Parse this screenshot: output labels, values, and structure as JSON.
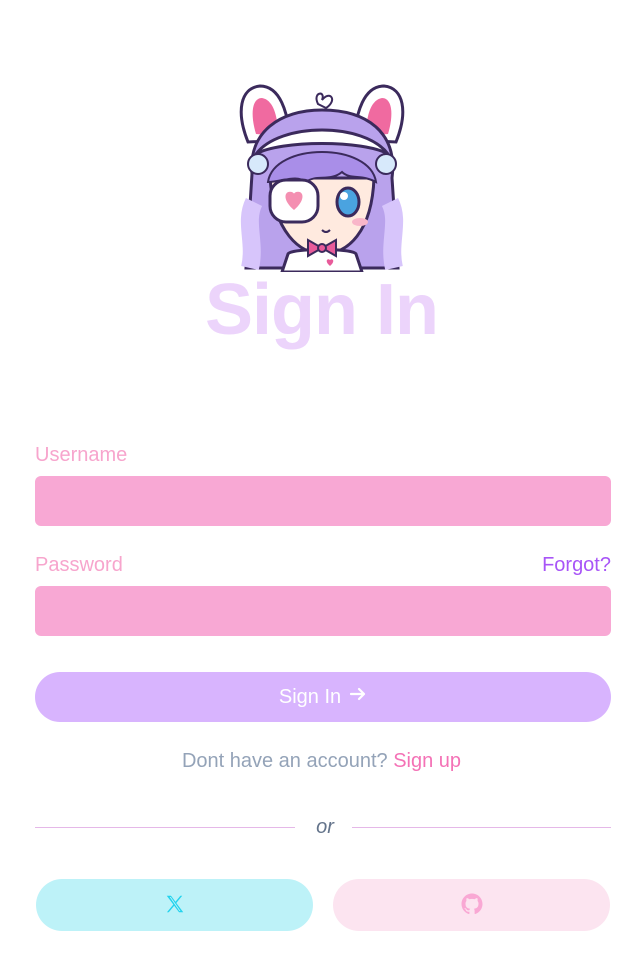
{
  "header": {
    "title": "Sign In"
  },
  "form": {
    "username_label": "Username",
    "username_value": "",
    "password_label": "Password",
    "password_value": "",
    "forgot_label": "Forgot?",
    "submit_label": "Sign In",
    "submit_icon": "arrow-right-icon"
  },
  "signup": {
    "prompt": "Dont have an account?",
    "link_label": "Sign up"
  },
  "divider": {
    "label": "or"
  },
  "social": [
    {
      "name": "x",
      "icon": "x-logo-icon",
      "color": "#22d3ee",
      "background": "#bdf2f8"
    },
    {
      "name": "github",
      "icon": "github-icon",
      "color": "#f9a8d4",
      "background": "#fce4f0"
    }
  ],
  "colors": {
    "title": "#ecd4fb",
    "label": "#f7a5cd",
    "input_bg": "#f8a8d4",
    "accent_purple": "#a855f7",
    "button_bg": "#d8b4fe",
    "link_pink": "#f472b6"
  }
}
